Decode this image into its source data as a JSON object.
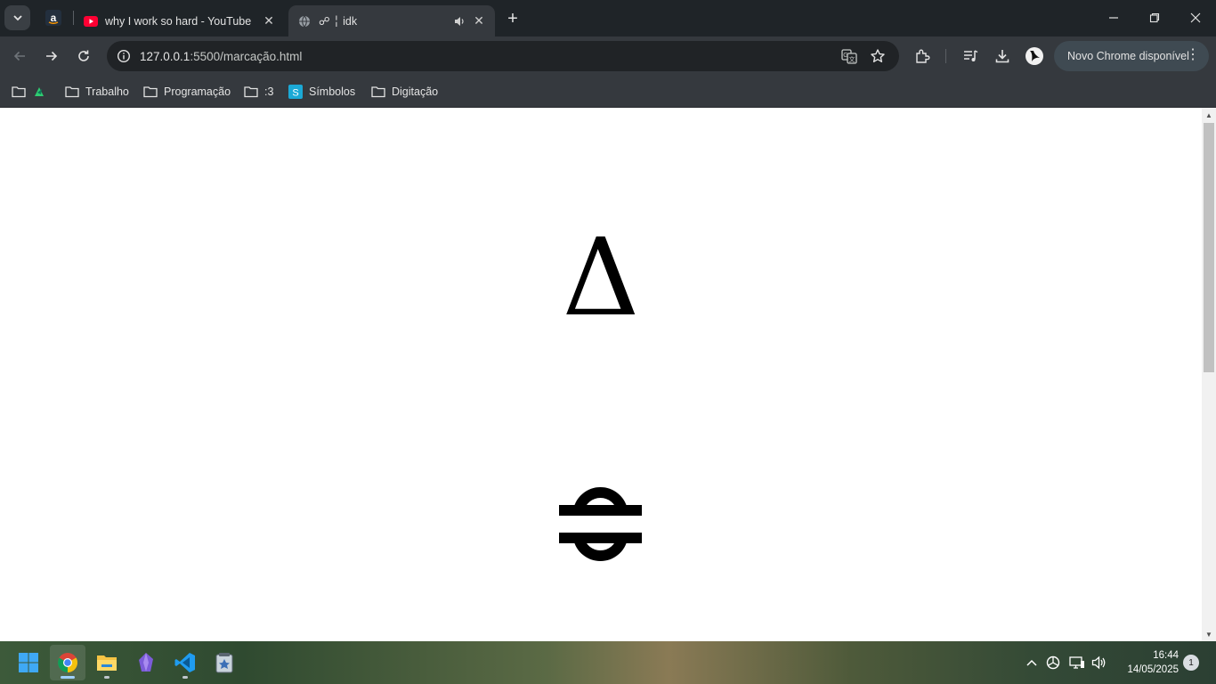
{
  "browser": {
    "tabs": [
      {
        "title": "why I work so hard - YouTube",
        "favicon": "youtube-icon",
        "active": false
      },
      {
        "title": "☍ ╎ idk",
        "favicon": "globe-icon",
        "active": true,
        "audio": true
      }
    ],
    "pinned_tab_favicon": "amazon-icon",
    "address_bar": {
      "host": "127.0.0.1",
      "path": ":5500/marcação.html"
    },
    "update_chip": "Novo Chrome disponível",
    "bookmarks": [
      {
        "label": "",
        "icon": "folder-icon"
      },
      {
        "label": "Trabalho",
        "icon": "folder-icon"
      },
      {
        "label": "Programação",
        "icon": "folder-icon"
      },
      {
        "label": ":3",
        "icon": "folder-icon"
      },
      {
        "label": "Símbolos",
        "icon": "symbols-site-icon"
      },
      {
        "label": "Digitação",
        "icon": "folder-icon"
      }
    ]
  },
  "page": {
    "glyph_top": "Δ",
    "glyph_bottom": "☍"
  },
  "taskbar": {
    "apps": [
      "windows-start-icon",
      "chrome-icon",
      "file-explorer-icon",
      "obsidian-icon",
      "vscode-icon",
      "app-icon"
    ],
    "clock_time": "16:44",
    "clock_date": "14/05/2025",
    "notification_count": "1"
  },
  "colors": {
    "titlebar": "#1f2428",
    "toolbar": "#35393e",
    "omnibox": "#202326",
    "youtube_red": "#ff0033",
    "page_bg": "#ffffff"
  }
}
